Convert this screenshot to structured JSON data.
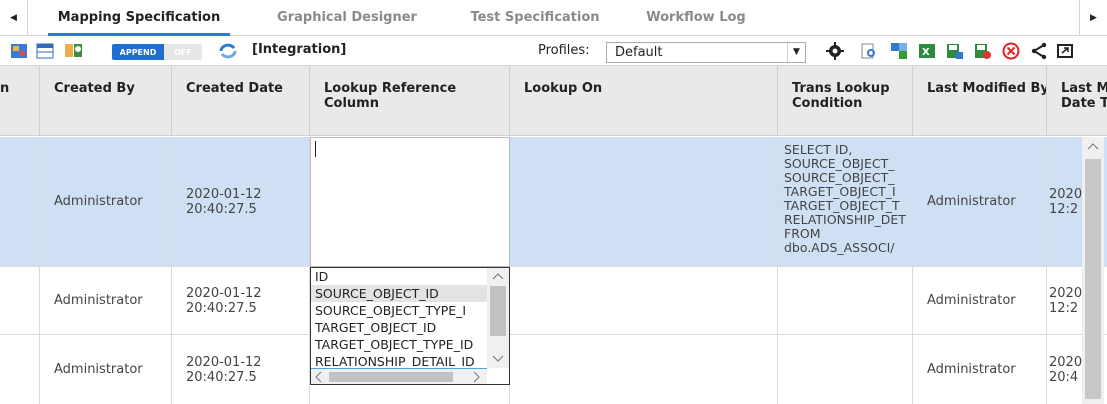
{
  "tabs": {
    "items": [
      {
        "label": "Mapping Specification"
      },
      {
        "label": "Graphical Designer"
      },
      {
        "label": "Test Specification"
      },
      {
        "label": "Workflow Log"
      }
    ]
  },
  "toolbar": {
    "append_on": "APPEND",
    "append_off": "OFF",
    "integration": "[Integration]",
    "profiles_label": "Profiles:",
    "profiles_value": "Default"
  },
  "headers": {
    "c0": "n",
    "created_by": "Created By",
    "created_date": "Created Date",
    "lookup_ref_line1": "Lookup Reference",
    "lookup_ref_line2": "Column",
    "lookup_on": "Lookup On",
    "trans_line1": "Trans Lookup",
    "trans_line2": "Condition",
    "last_mod_by": "Last Modified By",
    "last_mod_date_line1": "Last M",
    "last_mod_date_line2": "Date T"
  },
  "rows": [
    {
      "created_by": "Administrator",
      "date1": "2020-01-12",
      "date2": "20:40:27.5",
      "last_mod_by": "Administrator",
      "lm1": "2020",
      "lm2": "12:2"
    },
    {
      "created_by": "Administrator",
      "date1": "2020-01-12",
      "date2": "20:40:27.5",
      "last_mod_by": "Administrator",
      "lm1": "2020",
      "lm2": "12:2"
    },
    {
      "created_by": "Administrator",
      "date1": "2020-01-12",
      "date2": "20:40:27.5",
      "last_mod_by": "Administrator",
      "lm1": "2020",
      "lm2": "20:4"
    }
  ],
  "sql_lines": [
    "SELECT ID,",
    "SOURCE_OBJECT_",
    "SOURCE_OBJECT_",
    "TARGET_OBJECT_I",
    "TARGET_OBJECT_T",
    "RELATIONSHIP_DET",
    "FROM",
    "dbo.ADS_ASSOCI/"
  ],
  "lookup_options": [
    "ID",
    "SOURCE_OBJECT_ID",
    "SOURCE_OBJECT_TYPE_I",
    "TARGET_OBJECT_ID",
    "TARGET_OBJECT_TYPE_ID",
    "RELATIONSHIP_DETAIL_ID"
  ],
  "colors": {
    "accent": "#2d7ad6",
    "selected_row": "#cfe0f5",
    "header_bg": "#e9e9e9"
  },
  "icons": [
    "mapping-icon",
    "table-icon",
    "users-icon",
    "refresh-icon",
    "settings-icon",
    "preview-icon",
    "sync-icon",
    "excel-icon",
    "save-icon",
    "save-as-icon",
    "close-icon",
    "share-icon",
    "expand-icon"
  ]
}
